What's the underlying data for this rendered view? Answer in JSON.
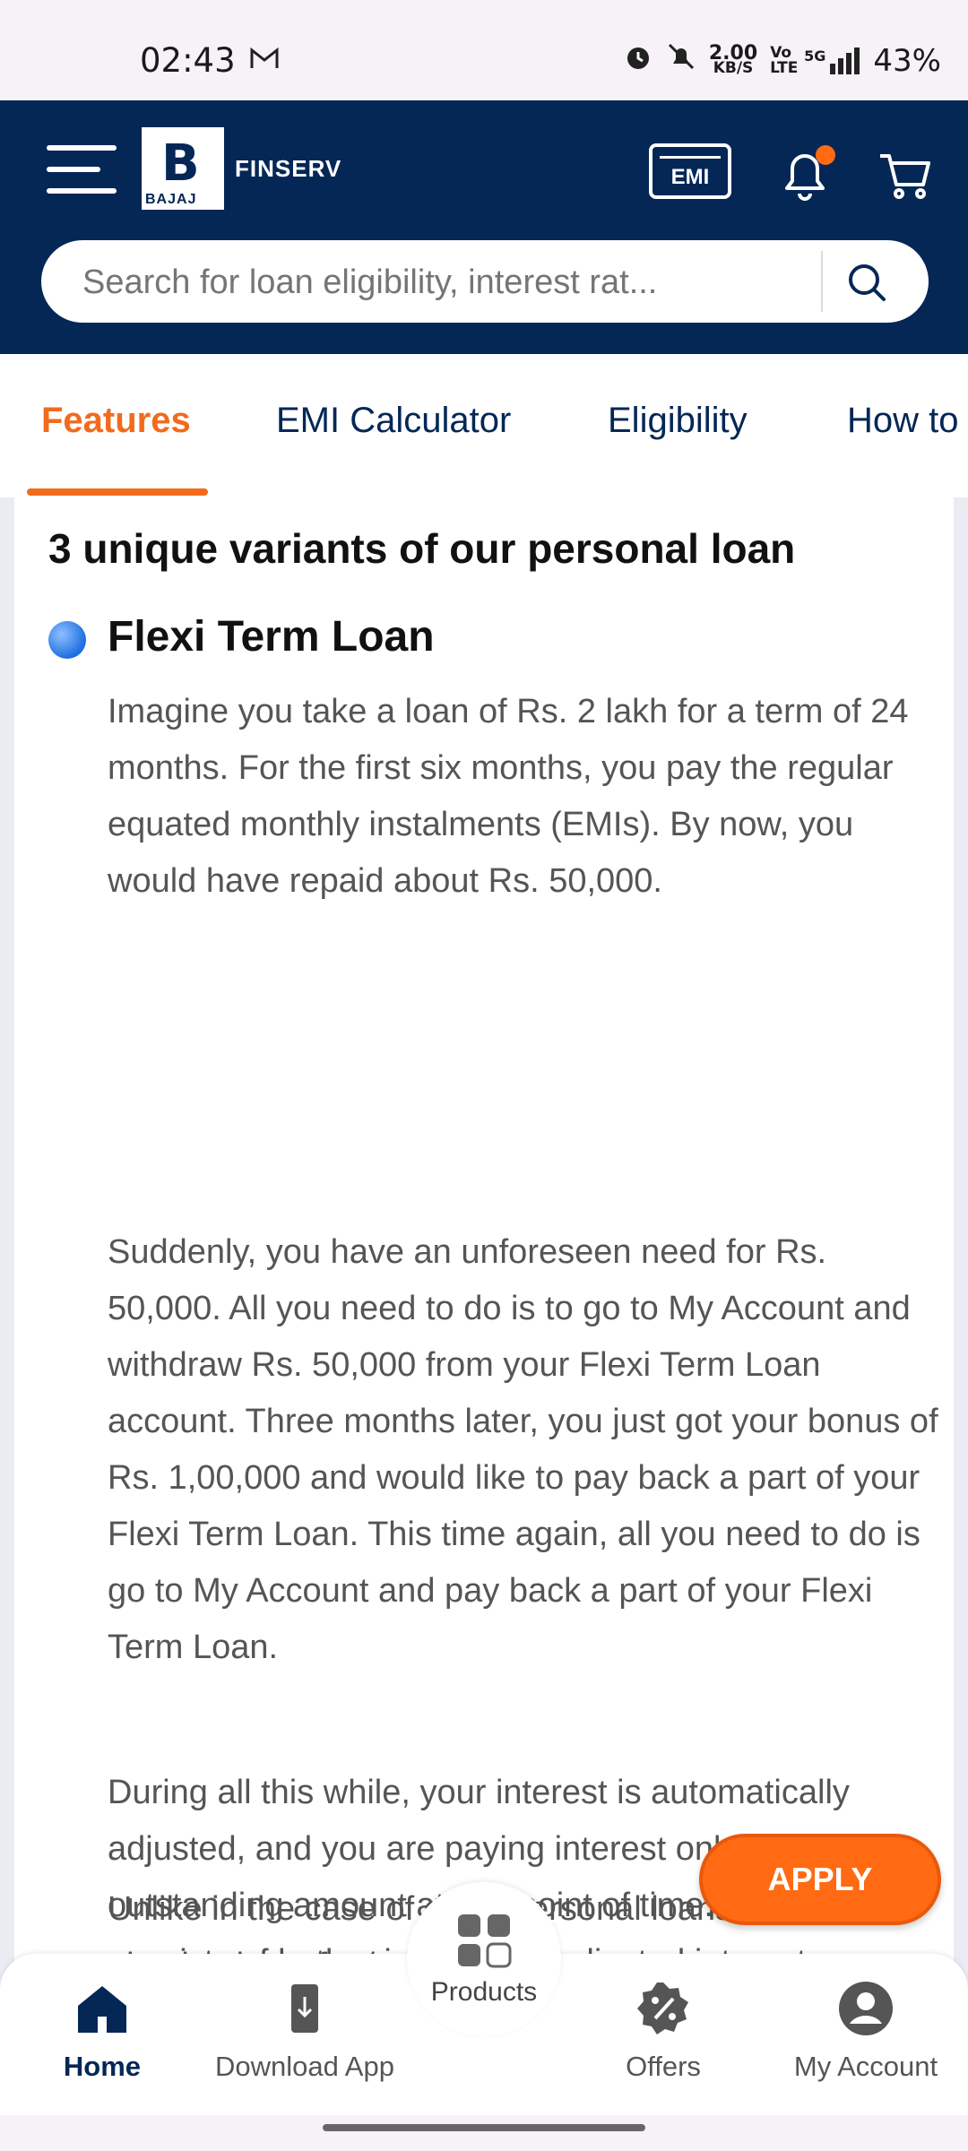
{
  "status_bar": {
    "time": "02:43",
    "mail_icon": "gmail-icon",
    "net_speed_value": "2.00",
    "net_speed_unit": "KB/S",
    "volte": "Vo LTE",
    "network": "5G",
    "battery": "43%"
  },
  "header": {
    "logo_letter": "B",
    "logo_brand": "BAJAJ",
    "logo_text": "FINSERV",
    "emi_label": "EMI",
    "search_placeholder": "Search for loan eligibility, interest rat..."
  },
  "tabs": [
    {
      "label": "Features",
      "active": true
    },
    {
      "label": "EMI Calculator",
      "active": false
    },
    {
      "label": "Eligibility",
      "active": false
    },
    {
      "label": "How to",
      "active": false
    }
  ],
  "content": {
    "heading": "3 unique variants of our personal loan",
    "variant_title": "Flexi Term Loan",
    "paragraphs": [
      "Imagine you take a loan of Rs. 2 lakh for a term of 24 months. For the first six months, you pay the regular equated monthly instalments (EMIs). By now, you would have repaid about Rs. 50,000.",
      "Suddenly, you have an unforeseen need for Rs. 50,000. All you need to do is to go to My Account and withdraw Rs. 50,000 from your Flexi Term Loan account. Three months later, you just got your bonus of Rs. 1,00,000 and would like to pay back a part of your Flexi Term Loan. This time again, all you need to do is go to My Account and pay back a part of your Flexi Term Loan.",
      "During all this while, your interest is automatically adjusted, and you are paying interest only on the outstanding amount at any point of time. Your EMI consists of both principal and adjusted interest.",
      "Unlike in the case of other personal loans, there are absolutely no fee/ penalty/ charges"
    ]
  },
  "apply_label": "APPLY",
  "bottom_nav": {
    "home": "Home",
    "download": "Download App",
    "products": "Products",
    "offers": "Offers",
    "account": "My Account"
  }
}
